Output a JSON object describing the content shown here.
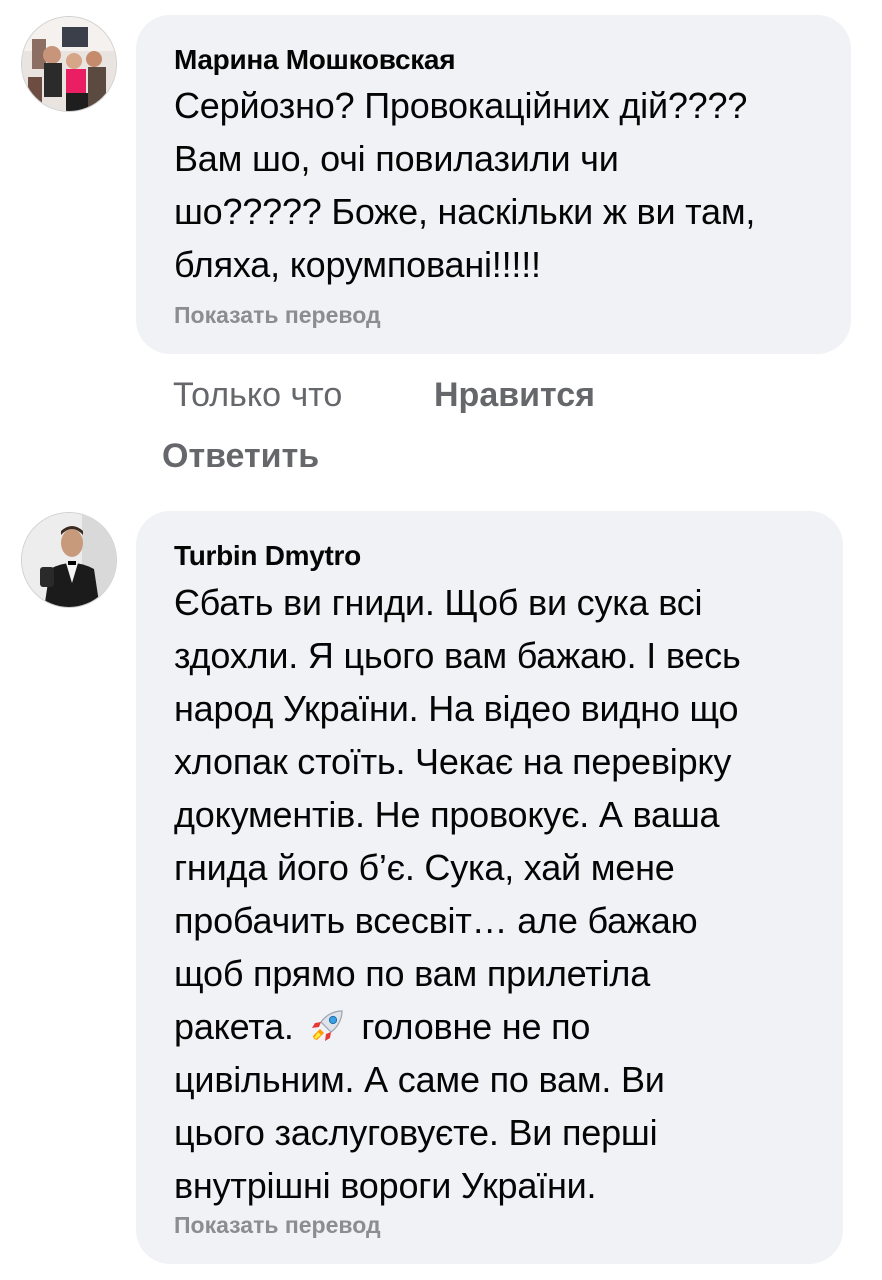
{
  "comments": [
    {
      "author": "Марина Мошковская",
      "lines": [
        "Серйозно? Провокаційних дій????",
        "Вам шо, очі повилазили чи",
        "шо????? Боже, наскільки ж ви там,",
        "бляха, корумповані!!!!!"
      ],
      "translate_label": "Показать перевод",
      "time": "Только что",
      "like_label": "Нравится",
      "reply_label": "Ответить"
    },
    {
      "author": "Turbin Dmytro",
      "lines": [
        "Єбать ви гниди. Щоб ви сука всі",
        "здохли. Я цього вам бажаю. І весь",
        "народ України. На відео видно що",
        "хлопак стоїть. Чекає на перевірку",
        "документів. Не провокує. А ваша",
        "гнида його б’є. Сука, хай мене",
        "пробачить всесвіт… але бажаю",
        "щоб прямо по вам прилетіла",
        "ракета.",
        "головне не по",
        "цивільним. А саме по вам. Ви",
        "цього заслуговуєте. Ви перші",
        "внутрішні вороги України."
      ],
      "emoji": "rocket-emoji",
      "translate_label": "Показать перевод"
    }
  ],
  "colors": {
    "bubble": "#f0f2f5",
    "secondary_text": "#65676b",
    "translate_text": "#8a8d91"
  }
}
